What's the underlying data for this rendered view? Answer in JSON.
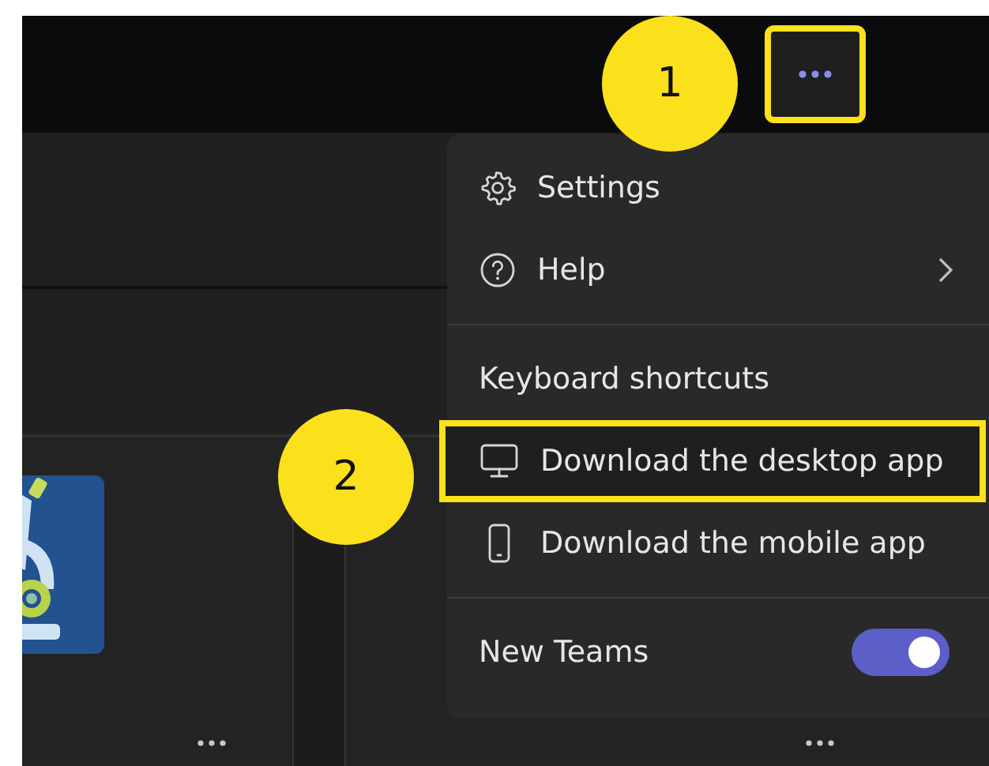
{
  "top_bar": {
    "more_button": {
      "highlighted": true
    }
  },
  "menu": {
    "items": [
      {
        "kind": "link",
        "label": "Settings",
        "highlighted": false
      },
      {
        "kind": "submenu",
        "label": "Help",
        "highlighted": false
      },
      {
        "kind": "divider"
      },
      {
        "kind": "plain",
        "label": "Keyboard shortcuts",
        "highlighted": false
      },
      {
        "kind": "link",
        "label": "Download the desktop app",
        "highlighted": true
      },
      {
        "kind": "link",
        "label": "Download the mobile app",
        "highlighted": false
      },
      {
        "kind": "divider"
      },
      {
        "kind": "toggle",
        "label": "New Teams",
        "on": true,
        "highlighted": false
      }
    ]
  },
  "callouts": [
    {
      "label": "1"
    },
    {
      "label": "2"
    }
  ]
}
